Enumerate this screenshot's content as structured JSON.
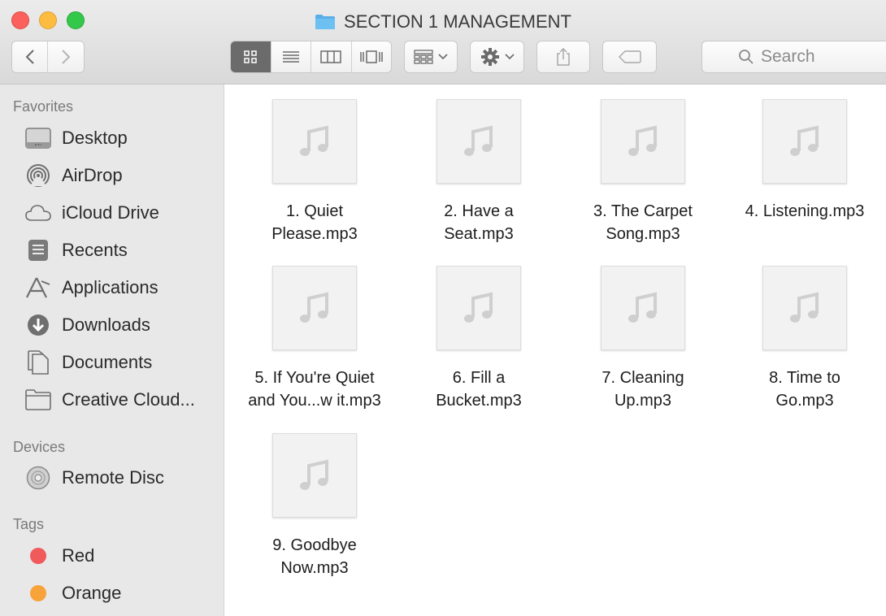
{
  "window": {
    "title": "SECTION 1 MANAGEMENT"
  },
  "toolbar": {
    "back_icon": "chevron-left-icon",
    "forward_icon": "chevron-right-icon",
    "view_modes": [
      "icon-view",
      "list-view",
      "column-view",
      "cover-flow-view"
    ],
    "active_view": "icon-view",
    "arrange_icon": "arrange-grid-icon",
    "action_icon": "gear-icon",
    "share_icon": "share-icon",
    "tag_icon": "tag-icon",
    "search_placeholder": "Search"
  },
  "sidebar": {
    "favorites_heading": "Favorites",
    "favorites": [
      {
        "label": "Desktop",
        "icon": "desktop-icon"
      },
      {
        "label": "AirDrop",
        "icon": "airdrop-icon"
      },
      {
        "label": "iCloud Drive",
        "icon": "cloud-icon"
      },
      {
        "label": "Recents",
        "icon": "recents-icon"
      },
      {
        "label": "Applications",
        "icon": "applications-icon"
      },
      {
        "label": "Downloads",
        "icon": "downloads-icon"
      },
      {
        "label": "Documents",
        "icon": "documents-icon"
      },
      {
        "label": "Creative Cloud...",
        "icon": "folder-icon"
      }
    ],
    "devices_heading": "Devices",
    "devices": [
      {
        "label": "Remote Disc",
        "icon": "disc-icon"
      }
    ],
    "tags_heading": "Tags",
    "tags": [
      {
        "label": "Red",
        "color": "#f05a5a"
      },
      {
        "label": "Orange",
        "color": "#f7a33a"
      }
    ]
  },
  "files": [
    {
      "line1": "1. Quiet",
      "line2": "Please.mp3"
    },
    {
      "line1": "2. Have a",
      "line2": "Seat.mp3"
    },
    {
      "line1": "3. The Carpet",
      "line2": "Song.mp3"
    },
    {
      "line1": "4. Listening.mp3",
      "line2": ""
    },
    {
      "line1": "5. If You're Quiet",
      "line2": "and You...w it.mp3"
    },
    {
      "line1": "6. Fill a",
      "line2": "Bucket.mp3"
    },
    {
      "line1": "7. Cleaning",
      "line2": "Up.mp3"
    },
    {
      "line1": "8. Time to",
      "line2": "Go.mp3"
    },
    {
      "line1": "9. Goodbye",
      "line2": "Now.mp3"
    }
  ],
  "colors": {
    "folder_blue": "#5aaee8",
    "active_segment": "#6b6b6b"
  }
}
